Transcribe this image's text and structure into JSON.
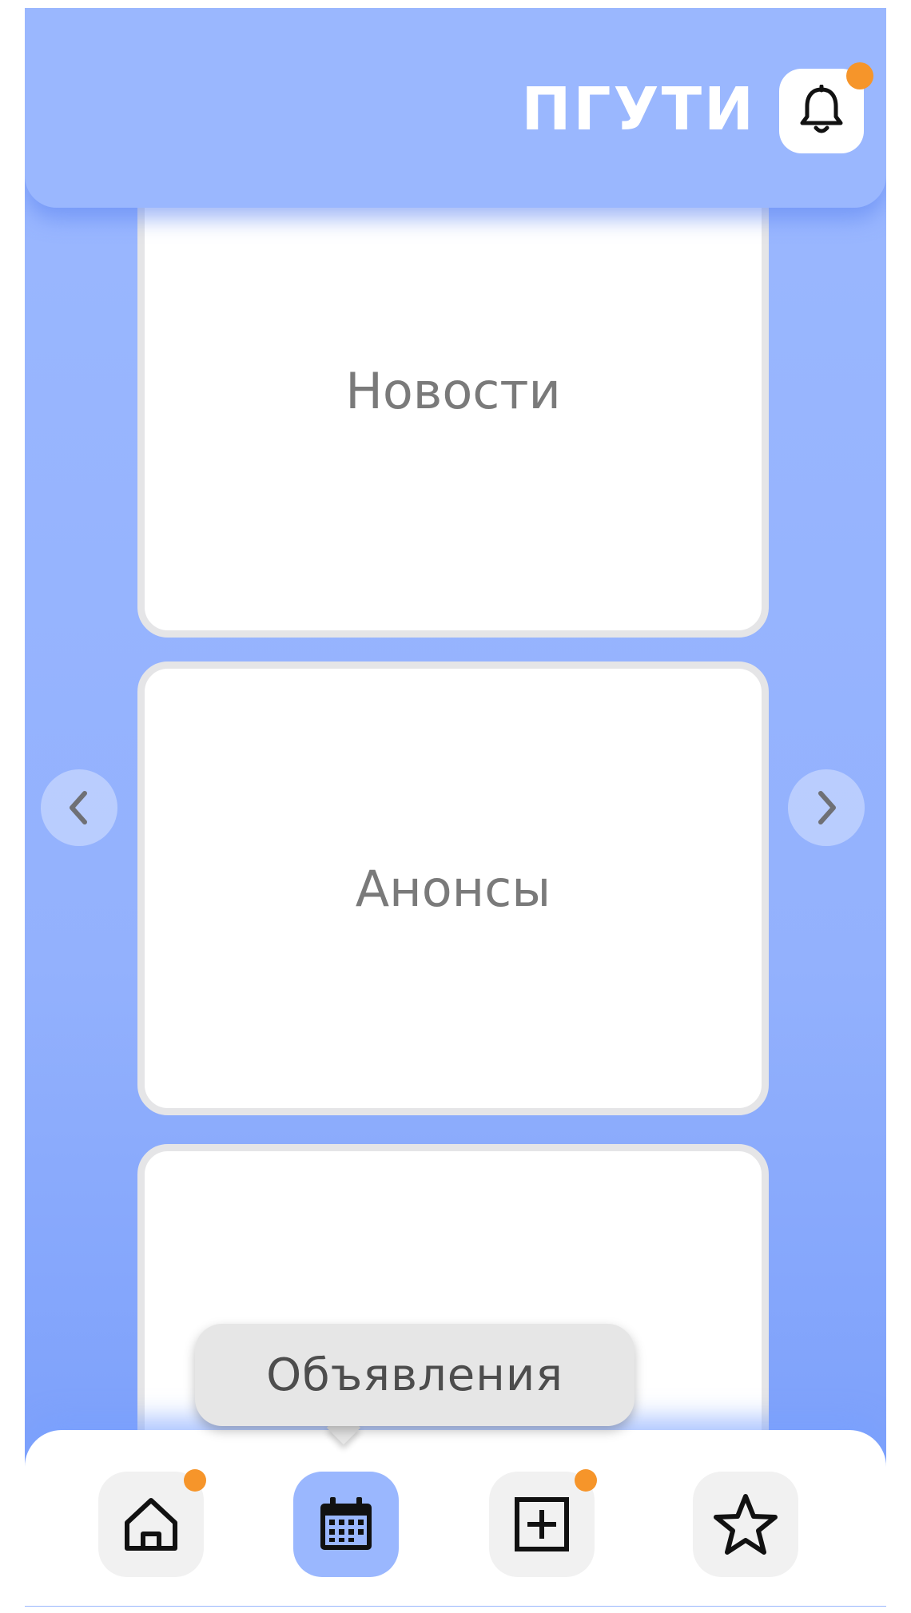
{
  "header": {
    "brand": "ПГУТИ",
    "notifications_badge": true
  },
  "cards": [
    {
      "label": "Новости"
    },
    {
      "label": "Анонсы"
    },
    {
      "label": ""
    }
  ],
  "carousel": {
    "prev_icon": "chevron-left-icon",
    "next_icon": "chevron-right-icon"
  },
  "tooltip": {
    "label": "Объявления"
  },
  "nav": {
    "items": [
      {
        "icon": "home-icon",
        "badge": true,
        "active": false
      },
      {
        "icon": "calendar-icon",
        "badge": false,
        "active": true
      },
      {
        "icon": "plus-square-icon",
        "badge": true,
        "active": false
      },
      {
        "icon": "star-icon",
        "badge": false,
        "active": false
      }
    ]
  },
  "colors": {
    "primary": "#9ab7fe",
    "badge": "#f6952a",
    "card_border": "#e5e5e7",
    "card_text": "#7a7a7a"
  }
}
